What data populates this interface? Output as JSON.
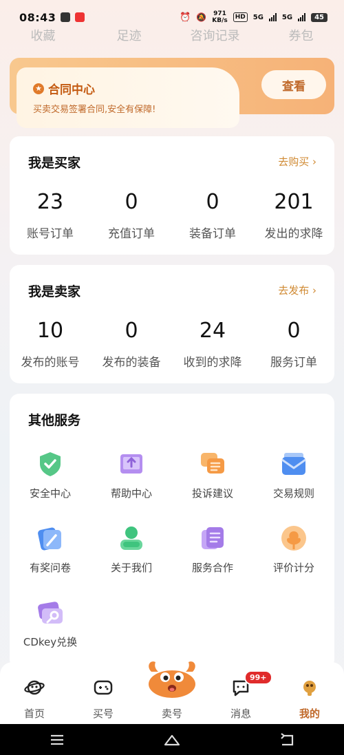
{
  "status_bar": {
    "time": "08:43",
    "speed_value": "971",
    "speed_unit": "KB/s",
    "hd": "HD",
    "net1": "5G",
    "net2": "5G",
    "battery": "45"
  },
  "top_nav": [
    "收藏",
    "足迹",
    "咨询记录",
    "券包"
  ],
  "contract": {
    "title": "合同中心",
    "subtitle": "买卖交易签署合同,安全有保障!",
    "button": "查看"
  },
  "buyer": {
    "title": "我是买家",
    "link": "去购买 ›",
    "stats": [
      {
        "value": "23",
        "label": "账号订单"
      },
      {
        "value": "0",
        "label": "充值订单"
      },
      {
        "value": "0",
        "label": "装备订单"
      },
      {
        "value": "201",
        "label": "发出的求降"
      }
    ]
  },
  "seller": {
    "title": "我是卖家",
    "link": "去发布 ›",
    "stats": [
      {
        "value": "10",
        "label": "发布的账号"
      },
      {
        "value": "0",
        "label": "发布的装备"
      },
      {
        "value": "24",
        "label": "收到的求降"
      },
      {
        "value": "0",
        "label": "服务订单"
      }
    ]
  },
  "services": {
    "title": "其他服务",
    "items": [
      {
        "label": "安全中心",
        "icon": "shield-check-icon",
        "color": "#4cc27a"
      },
      {
        "label": "帮助中心",
        "icon": "book-icon",
        "color": "#a47be8"
      },
      {
        "label": "投诉建议",
        "icon": "chat-bubbles-icon",
        "color": "#f5a04a"
      },
      {
        "label": "交易规则",
        "icon": "envelope-icon",
        "color": "#4e8ef0"
      },
      {
        "label": "有奖问卷",
        "icon": "pencil-card-icon",
        "color": "#4e8ef0"
      },
      {
        "label": "关于我们",
        "icon": "person-icon",
        "color": "#3fc47e"
      },
      {
        "label": "服务合作",
        "icon": "document-icon",
        "color": "#a47be8"
      },
      {
        "label": "评价计分",
        "icon": "flower-icon",
        "color": "#f5a04a"
      },
      {
        "label": "CDkey兑换",
        "icon": "ticket-key-icon",
        "color": "#a47be8"
      }
    ]
  },
  "bottom_nav": {
    "items": [
      {
        "label": "首页",
        "icon": "planet-icon"
      },
      {
        "label": "买号",
        "icon": "gamepad-icon"
      },
      {
        "label": "卖号",
        "icon": "crab-mascot-icon"
      },
      {
        "label": "消息",
        "icon": "message-icon",
        "badge": "99+"
      },
      {
        "label": "我的",
        "icon": "profile-icon"
      }
    ]
  }
}
